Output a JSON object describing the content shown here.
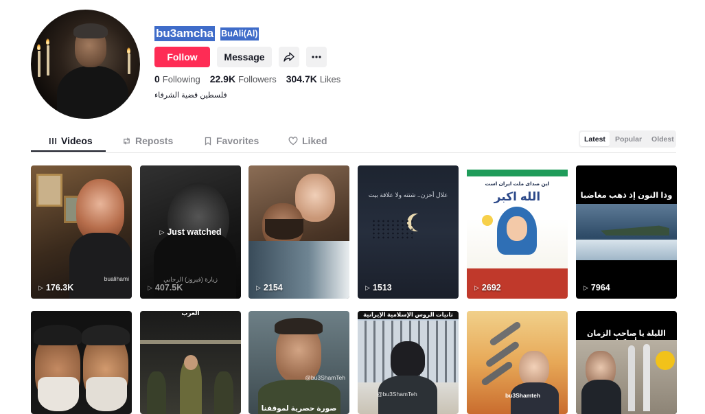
{
  "profile": {
    "username": "bu3amcha",
    "nickname": "BuAli(Al)",
    "bio": "فلسطين قضية الشرفاء",
    "buttons": {
      "follow": "Follow",
      "message": "Message"
    },
    "stats": {
      "following": {
        "value": "0",
        "label": "Following"
      },
      "followers": {
        "value": "22.9K",
        "label": "Followers"
      },
      "likes": {
        "value": "304.7K",
        "label": "Likes"
      }
    }
  },
  "tabs": [
    {
      "label": "Videos",
      "icon": "grid-bars-icon",
      "active": true
    },
    {
      "label": "Reposts",
      "icon": "repost-icon"
    },
    {
      "label": "Favorites",
      "icon": "bookmark-icon"
    },
    {
      "label": "Liked",
      "icon": "heart-outline-icon"
    }
  ],
  "sort": {
    "latest": "Latest",
    "popular": "Popular",
    "oldest": "Oldest",
    "selected": "Latest"
  },
  "videos": [
    {
      "views": "176.3K",
      "watermark": "bualihami"
    },
    {
      "views": "407.5K",
      "overlay": "Just watched",
      "caption_bottom": "زيارة (فيروز) الرحابي"
    },
    {
      "views": "2154"
    },
    {
      "views": "1513",
      "caption": "علال أحزن.. شتته ولا علاقة بيت"
    },
    {
      "views": "2692",
      "caption_top": "این صدای ملت ایران است",
      "caption_mid": "الله اکبر"
    },
    {
      "views": "7964",
      "caption": "وذا النون إذ ذهب مغاضبا"
    },
    {
      "views": ""
    },
    {
      "views": "",
      "caption": "العرب"
    },
    {
      "views": "",
      "caption": "صورة حصرية لموقفنا",
      "watermark": "@bu3ShamTeh"
    },
    {
      "views": "",
      "caption": "ثانيات الروس  الإسلامية الإيرانية",
      "watermark": "@bu3ShamTeh"
    },
    {
      "views": "",
      "watermark": "bu3Shamteh"
    },
    {
      "views": "",
      "caption": "الليلة يا صاحب الزمان أدركنا"
    }
  ],
  "colors": {
    "accent": "#fe2c55",
    "highlight": "#3f6cc9",
    "text": "#161823",
    "muted": "#8a8b91"
  }
}
